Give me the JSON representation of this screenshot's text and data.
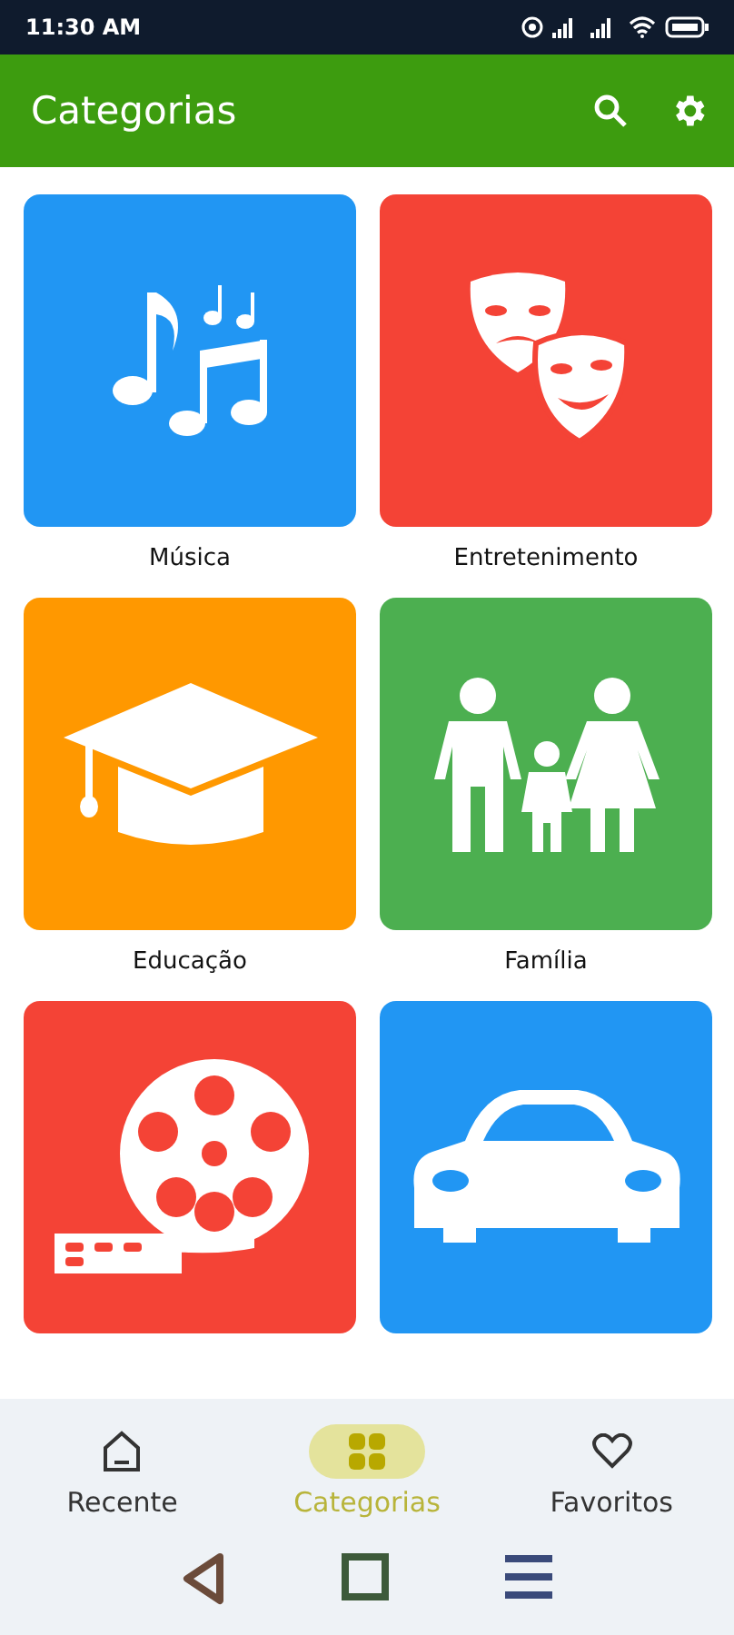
{
  "status_bar": {
    "time": "11:30 AM"
  },
  "app_bar": {
    "title": "Categorias"
  },
  "categories": [
    {
      "name": "Música",
      "color": "#2196f3",
      "kind": "music"
    },
    {
      "name": "Entretenimento",
      "color": "#f44336",
      "kind": "masks"
    },
    {
      "name": "Educação",
      "color": "#ff9800",
      "kind": "education"
    },
    {
      "name": "Família",
      "color": "#4caf50",
      "kind": "family"
    },
    {
      "color": "#f44336",
      "kind": "film"
    },
    {
      "color": "#2196f3",
      "kind": "car"
    }
  ],
  "bottom_nav": [
    {
      "label": "Recente",
      "kind": "home",
      "selected": false
    },
    {
      "label": "Categorias",
      "kind": "grid",
      "selected": true
    },
    {
      "label": "Favoritos",
      "kind": "heart",
      "selected": false
    }
  ]
}
